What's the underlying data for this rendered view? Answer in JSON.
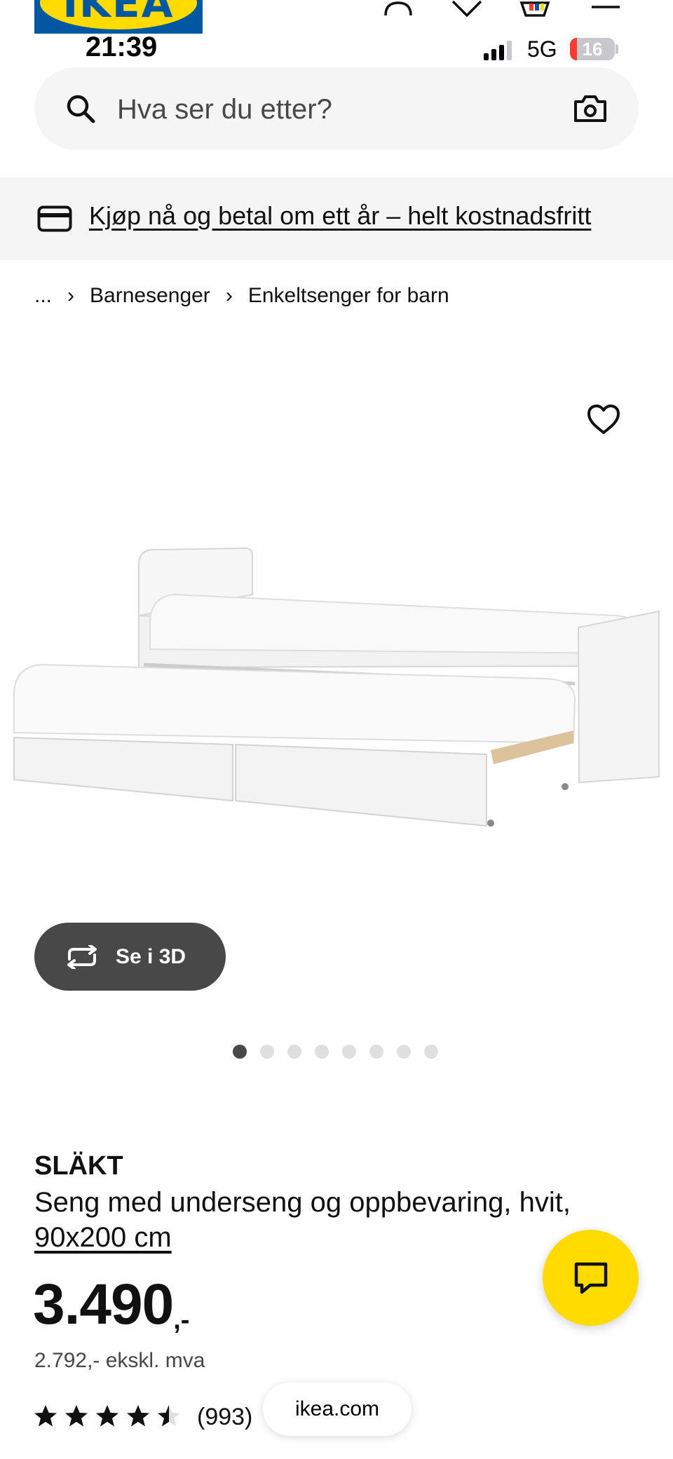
{
  "header": {
    "logo_text": "IKEA",
    "icons": [
      "profile-icon",
      "favourites-icon",
      "basket-icon",
      "menu-icon"
    ]
  },
  "status_bar": {
    "time": "21:39",
    "network": "5G",
    "battery": "16",
    "battery_level": 0.16
  },
  "search": {
    "placeholder": "Hva ser du etter?"
  },
  "banner": {
    "text": "Kjøp nå og betal om ett år – helt kostnadsfritt"
  },
  "breadcrumb": {
    "items": [
      "...",
      "Barnesenger",
      "Enkeltsenger for barn"
    ],
    "separator": "›"
  },
  "gallery": {
    "view_3d_label": "Se i 3D",
    "image_count": 8,
    "active_index": 0
  },
  "product": {
    "name": "SLÄKT",
    "description": "Seng med underseng og oppbevaring, hvit,",
    "size": "90x200 cm",
    "price": "3.490",
    "price_suffix": ",-",
    "price_ex_vat": "2.792,- ekskl. mva",
    "rating": 4.5,
    "review_count": "(993)"
  },
  "browser": {
    "url": "ikea.com"
  },
  "colors": {
    "brand_blue": "#0058a3",
    "brand_yellow": "#ffdb00",
    "dark_grey": "#484848",
    "light_grey": "#f5f5f5"
  }
}
